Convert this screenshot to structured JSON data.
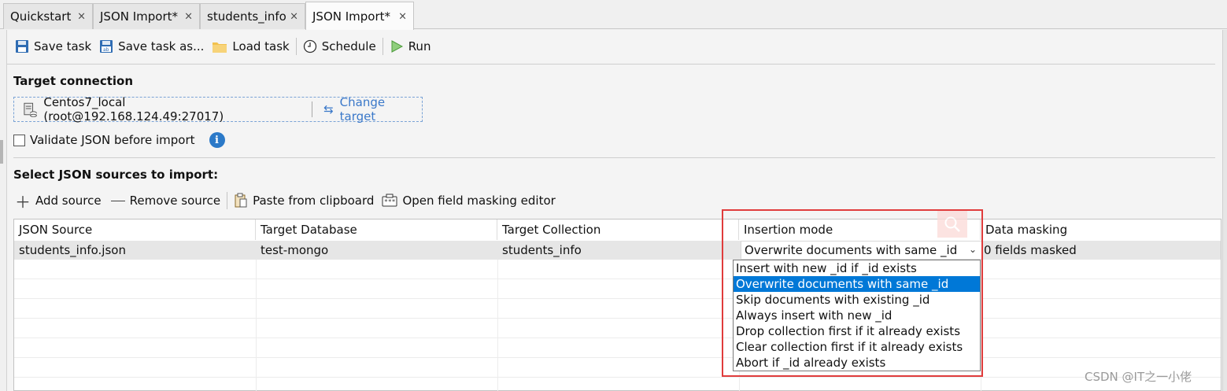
{
  "tabs": [
    {
      "label": "Quickstart",
      "close": "×"
    },
    {
      "label": "JSON Import*",
      "close": "×"
    },
    {
      "label": "students_info",
      "close": "×"
    },
    {
      "label": "JSON Import*",
      "close": "×"
    }
  ],
  "toolbar": {
    "save_task": "Save task",
    "save_task_as": "Save task as...",
    "load_task": "Load task",
    "schedule": "Schedule",
    "run": "Run"
  },
  "target": {
    "heading": "Target connection",
    "connection": "Centos7_local (root@192.168.124.49:27017)",
    "change_target": "Change target"
  },
  "validate": {
    "label": "Validate JSON before import",
    "checked": false,
    "info": "i"
  },
  "sources": {
    "heading": "Select JSON sources to import:",
    "add": "Add source",
    "remove": "Remove source",
    "paste": "Paste from clipboard",
    "masking_editor": "Open field masking editor"
  },
  "grid": {
    "columns": [
      "JSON Source",
      "Target Database",
      "Target Collection",
      "Insertion mode",
      "Data masking"
    ],
    "rows": [
      {
        "source": "students_info.json",
        "database": "test-mongo",
        "collection": "students_info",
        "mode": "Overwrite documents with same _id",
        "masking": "0 fields masked"
      }
    ]
  },
  "insertion_mode_options": [
    "Insert with new _id if _id exists",
    "Overwrite documents with same _id",
    "Skip documents with existing _id",
    "Always insert with new _id",
    "Drop collection first if it already exists",
    "Clear collection first if it already exists",
    "Abort if _id already exists"
  ],
  "selected_option_index": 1,
  "colors": {
    "accent": "#0078d7",
    "link": "#3a78c9",
    "highlight_box": "#e03c3c"
  },
  "watermark": "CSDN @IT之一小佬"
}
